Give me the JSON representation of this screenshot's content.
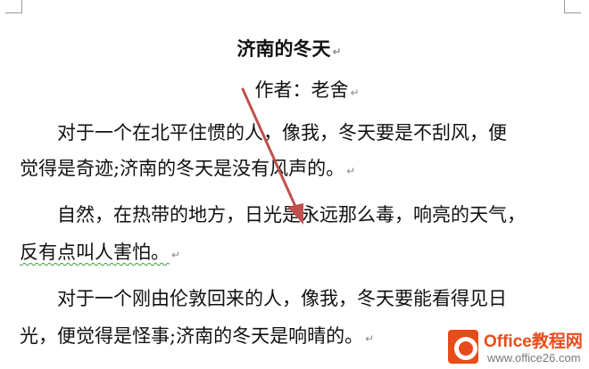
{
  "document": {
    "title": "济南的冬天",
    "author": "作者：老舍",
    "paragraph_mark": "↵",
    "paragraphs": [
      {
        "line1": "对于一个在北平住惯的人，像我，冬天要是不刮风，便",
        "line2": "觉得是奇迹;济南的冬天是没有风声的。"
      },
      {
        "line1": "自然，在热带的地方，日光是永远那么毒，响亮的天气，",
        "line2": "反有点叫人害怕。"
      },
      {
        "line1": "对于一个刚由伦敦回来的人，像我，冬天要能看得见日",
        "line2": "光，便觉得是怪事;济南的冬天是响晴的。"
      }
    ]
  },
  "watermark": {
    "brand": "Office",
    "brand_cn": "教程网",
    "url": "www.office26.com"
  },
  "colors": {
    "arrow": "#c0504d",
    "watermark": "#e84c1a",
    "spellcheck": "#3aa03a"
  }
}
